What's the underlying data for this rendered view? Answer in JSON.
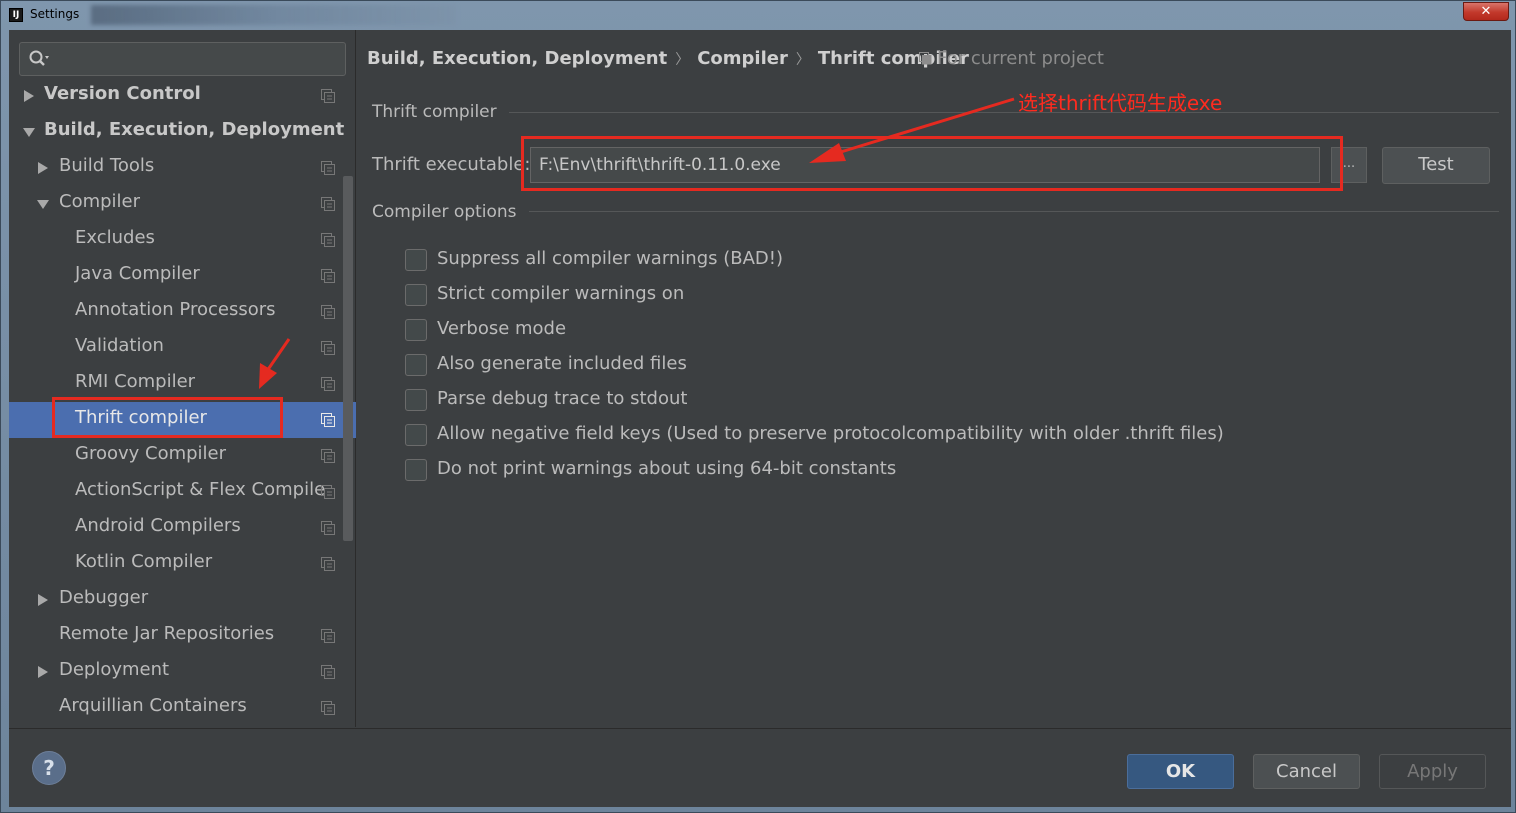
{
  "window": {
    "title": "Settings",
    "app_icon": "IJ",
    "close": "✕"
  },
  "search": {
    "placeholder": ""
  },
  "tree": [
    {
      "label": "Version Control",
      "bold": true,
      "arrow": "right"
    },
    {
      "label": "Build, Execution, Deployment",
      "bold": true,
      "arrow": "down"
    },
    {
      "label": "Build Tools",
      "arrow": "right"
    },
    {
      "label": "Compiler",
      "arrow": "down"
    },
    {
      "label": "Excludes"
    },
    {
      "label": "Java Compiler"
    },
    {
      "label": "Annotation Processors"
    },
    {
      "label": "Validation"
    },
    {
      "label": "RMI Compiler"
    },
    {
      "label": "Thrift compiler",
      "selected": true
    },
    {
      "label": "Groovy Compiler"
    },
    {
      "label": "ActionScript & Flex Compile"
    },
    {
      "label": "Android Compilers"
    },
    {
      "label": "Kotlin Compiler"
    },
    {
      "label": "Debugger",
      "arrow": "right"
    },
    {
      "label": "Remote Jar Repositories"
    },
    {
      "label": "Deployment",
      "arrow": "right"
    },
    {
      "label": "Arquillian Containers"
    }
  ],
  "breadcrumb": {
    "part1": "Build, Execution, Deployment",
    "sep": "〉",
    "part2": "Compiler",
    "part3": "Thrift compiler"
  },
  "scope_label": "For current project",
  "thrift_group": {
    "title": "Thrift compiler",
    "exe_label": "Thrift executable:",
    "exe_value": "F:\\Env\\thrift\\thrift-0.11.0.exe",
    "browse": "...",
    "test": "Test"
  },
  "options_group": {
    "title": "Compiler options",
    "options": [
      "Suppress all compiler warnings (BAD!)",
      "Strict compiler warnings on",
      "Verbose mode",
      "Also generate included files",
      "Parse debug trace to stdout",
      "Allow negative field keys (Used to preserve protocolcompatibility with older .thrift files)",
      "Do not print warnings about using 64-bit constants"
    ]
  },
  "annotation": {
    "text": "选择thrift代码生成exe",
    "color": "#ff2b1f"
  },
  "buttons": {
    "help": "?",
    "ok": "OK",
    "cancel": "Cancel",
    "apply": "Apply"
  },
  "colors": {
    "background": "#3c3f41",
    "selection": "#4b6eaf",
    "ok_button": "#365880",
    "annotation_red": "#e52a20"
  }
}
